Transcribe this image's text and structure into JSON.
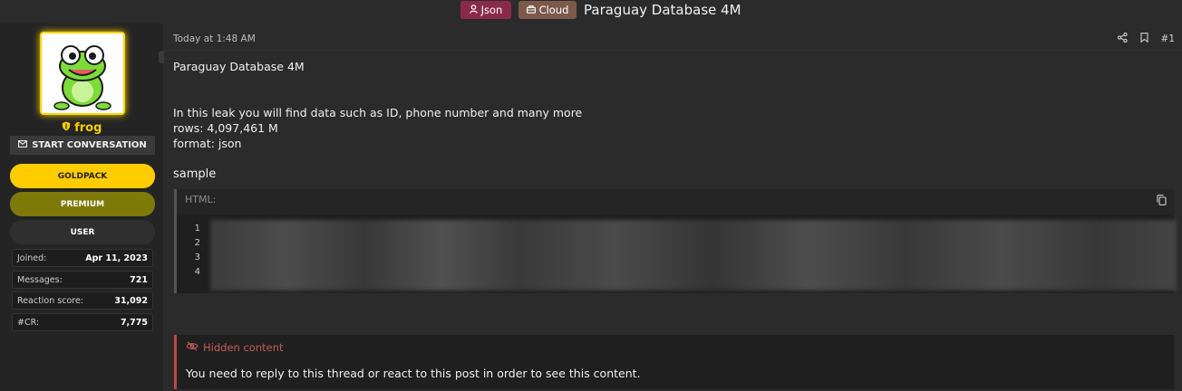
{
  "thread": {
    "prefixes": [
      {
        "label": "Json",
        "icon": "user-icon",
        "color": "#8a2a4a"
      },
      {
        "label": "Cloud",
        "icon": "briefcase-icon",
        "color": "#7b5a4c"
      }
    ],
    "title": "Paraguay Database 4M"
  },
  "user": {
    "avatar": "frog-avatar",
    "name": "frog",
    "start_conversation": "START CONVERSATION",
    "banners": [
      "GOLDPACK",
      "PREMIUM",
      "USER"
    ],
    "stats": [
      {
        "label": "Joined:",
        "value": "Apr 11, 2023"
      },
      {
        "label": "Messages:",
        "value": "721"
      },
      {
        "label": "Reaction score:",
        "value": "31,092"
      },
      {
        "label": "#CR:",
        "value": "7,775"
      }
    ]
  },
  "post": {
    "date": "Today at 1:48 AM",
    "number": "#1",
    "title_line": "Paraguay Database 4M",
    "lines": [
      "In this leak you will find data such as ID, phone number and many more",
      "rows: 4,097,461 M",
      "format: json"
    ],
    "sample_label": "sample",
    "code": {
      "lang_label": "HTML:",
      "line_numbers": [
        "1",
        "2",
        "3",
        "4"
      ]
    },
    "hidden": {
      "title": "Hidden content",
      "message": "You need to reply to this thread or react to this post in order to see this content."
    }
  },
  "colors": {
    "accent_gold": "#ffcc00",
    "hidden_red": "#c85a5a",
    "premium": "#7d7a0a"
  }
}
